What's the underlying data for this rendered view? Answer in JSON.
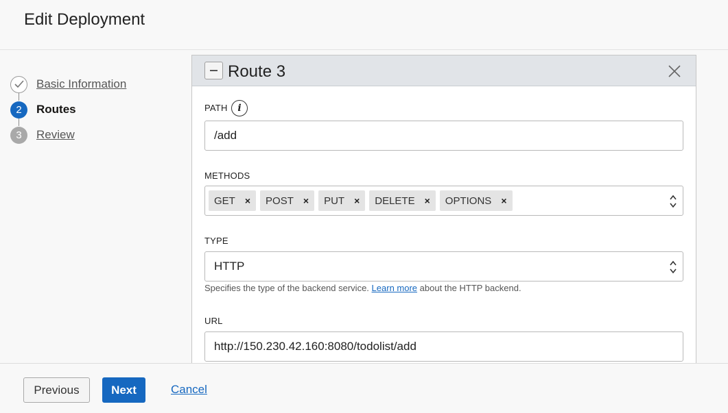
{
  "header": {
    "title": "Edit Deployment"
  },
  "steps": [
    {
      "number": "",
      "label": "Basic Information",
      "state": "completed"
    },
    {
      "number": "2",
      "label": "Routes",
      "state": "current"
    },
    {
      "number": "3",
      "label": "Review",
      "state": "upcoming"
    }
  ],
  "route": {
    "title": "Route 3",
    "path": {
      "label": "PATH",
      "value": "/add"
    },
    "methods": {
      "label": "METHODS",
      "chips": [
        "GET",
        "POST",
        "PUT",
        "DELETE",
        "OPTIONS"
      ],
      "remove_symbol": "×"
    },
    "type": {
      "label": "TYPE",
      "value": "HTTP",
      "help_prefix": "Specifies the type of the backend service.",
      "help_link": "Learn more",
      "help_suffix": "about the HTTP backend."
    },
    "url": {
      "label": "URL",
      "value": "http://150.230.42.160:8080/todolist/add"
    }
  },
  "footer": {
    "previous_label": "Previous",
    "next_label": "Next",
    "cancel_label": "Cancel"
  },
  "colors": {
    "accent": "#1668c0",
    "panel_header": "#e1e4e8",
    "chip": "#e4e4e4"
  }
}
